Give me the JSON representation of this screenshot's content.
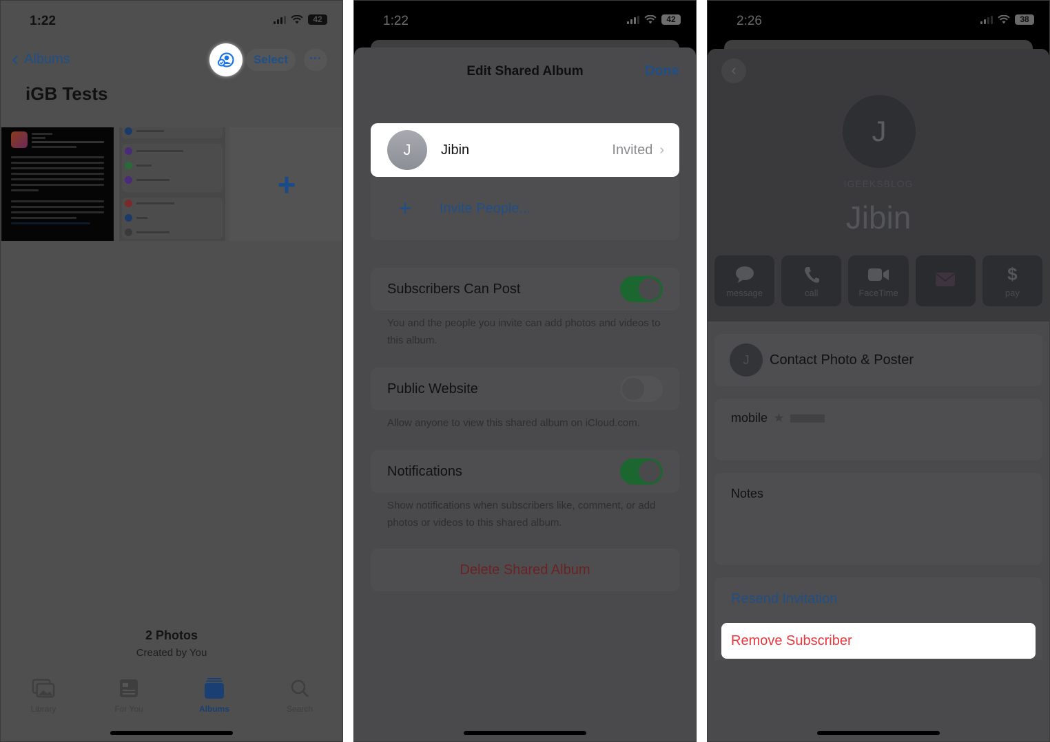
{
  "panel1": {
    "status": {
      "time": "1:22",
      "battery": "42"
    },
    "nav": {
      "back_label": "Albums",
      "select_label": "Select",
      "more_label": "···"
    },
    "album_title": "iGB Tests",
    "add_label": "+",
    "summary": {
      "count": "2 Photos",
      "creator": "Created by You"
    },
    "tabs": [
      {
        "label": "Library",
        "icon": "photo-stack-icon",
        "active": false
      },
      {
        "label": "For You",
        "icon": "for-you-icon",
        "active": false
      },
      {
        "label": "Albums",
        "icon": "albums-icon",
        "active": true
      },
      {
        "label": "Search",
        "icon": "search-icon",
        "active": false
      }
    ]
  },
  "panel2": {
    "status": {
      "time": "1:22",
      "battery": "42"
    },
    "title": "Edit Shared Album",
    "done_label": "Done",
    "member": {
      "initial": "J",
      "name": "Jibin",
      "state": "Invited"
    },
    "invite_label": "Invite People...",
    "settings": [
      {
        "label": "Subscribers Can Post",
        "on": true,
        "footnote": "You and the people you invite can add photos and videos to this album."
      },
      {
        "label": "Public Website",
        "on": false,
        "footnote": "Allow anyone to view this shared album on iCloud.com."
      },
      {
        "label": "Notifications",
        "on": true,
        "footnote": "Show notifications when subscribers like, comment, or add photos or videos to this shared album."
      }
    ],
    "delete_label": "Delete Shared Album"
  },
  "panel3": {
    "status": {
      "time": "2:26",
      "battery": "38"
    },
    "contact": {
      "initial": "J",
      "organization": "IGEEKSBLOG",
      "name": "Jibin"
    },
    "actions": [
      {
        "label": "message",
        "icon": "message-icon",
        "enabled": true
      },
      {
        "label": "call",
        "icon": "phone-icon",
        "enabled": true
      },
      {
        "label": "FaceTime",
        "icon": "video-icon",
        "enabled": true
      },
      {
        "label": "",
        "icon": "mail-icon",
        "enabled": false
      },
      {
        "label": "pay",
        "icon": "dollar-icon",
        "enabled": true
      }
    ],
    "contact_photo_label": "Contact Photo & Poster",
    "mobile_label": "mobile",
    "notes_label": "Notes",
    "resend_label": "Resend Invitation",
    "remove_label": "Remove Subscriber"
  },
  "colors": {
    "accent_blue": "#1f4f86",
    "destructive_red": "#e8373c",
    "toggle_on_green": "#1c6630"
  }
}
